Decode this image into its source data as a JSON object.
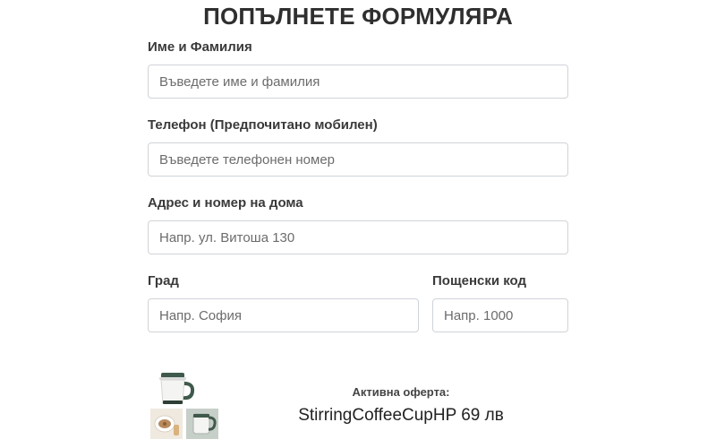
{
  "form": {
    "title": "ПОПЪЛНЕТЕ ФОРМУЛЯРА",
    "fields": {
      "name": {
        "label": "Име и Фамилия",
        "placeholder": "Въведете име и фамилия",
        "value": ""
      },
      "phone": {
        "label": "Телефон (Предпочитано мобилен)",
        "placeholder": "Въведете телефонен номер",
        "value": ""
      },
      "address": {
        "label": "Адрес и номер на дома",
        "placeholder": "Напр. ул. Витоша 130",
        "value": ""
      },
      "city": {
        "label": "Град",
        "placeholder": "Напр. София",
        "value": ""
      },
      "postal_code": {
        "label": "Пощенски код",
        "placeholder": "Напр. 1000",
        "value": ""
      }
    }
  },
  "offer": {
    "label": "Активна оферта:",
    "product": "StirringCoffeeCupHP 69 лв",
    "images": [
      "mug-main-image",
      "mug-detail-image-1",
      "mug-detail-image-2"
    ],
    "colors": {
      "mug_body": "#f4f4f2",
      "mug_accent": "#3f5a4c"
    }
  }
}
